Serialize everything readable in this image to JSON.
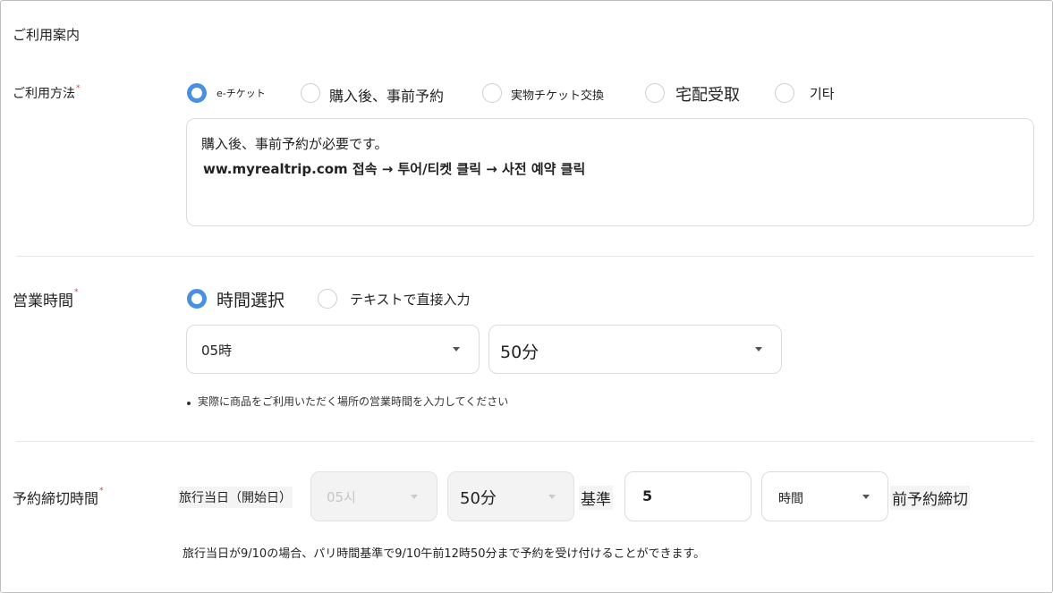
{
  "section_title": "ご利用案内",
  "usage": {
    "label": "ご利用方法",
    "required_mark": "*",
    "options": [
      {
        "label": "e-チケット",
        "selected": true
      },
      {
        "label": "購入後、事前予約",
        "selected": false
      },
      {
        "label": "実物チケット交換",
        "selected": false
      },
      {
        "label": "宅配受取",
        "selected": false
      },
      {
        "label": "기타",
        "selected": false
      }
    ],
    "text_line1": "購入後、事前予約が必要です。",
    "text_line2": "ww.myrealtrip.com 접속 → 투어/티켓 클릭 → 사전 예약 클릭"
  },
  "hours": {
    "label": "営業時間",
    "required_mark": "*",
    "options": [
      {
        "label": "時間選択",
        "selected": true
      },
      {
        "label": "テキストで直接入力",
        "selected": false
      }
    ],
    "hour_value": "05時",
    "minute_value": "50分",
    "hint": "実際に商品をご利用いただく場所の営業時間を入力してください"
  },
  "deadline": {
    "label": "予約締切時間",
    "required_mark": "*",
    "prefix": "旅行当日（開始日）",
    "hour_value": "05시",
    "minute_value": "50分",
    "basis": "基準",
    "amount_value": "5",
    "unit_value": "時間",
    "suffix": "前予約締切",
    "note": "旅行当日が9/10の場合、パリ時間基準で9/10午前12時50分まで予約を受け付けることができます。"
  },
  "colors": {
    "accent": "#4a90e2",
    "required": "#e23b3b",
    "border": "#dcdcdc"
  }
}
